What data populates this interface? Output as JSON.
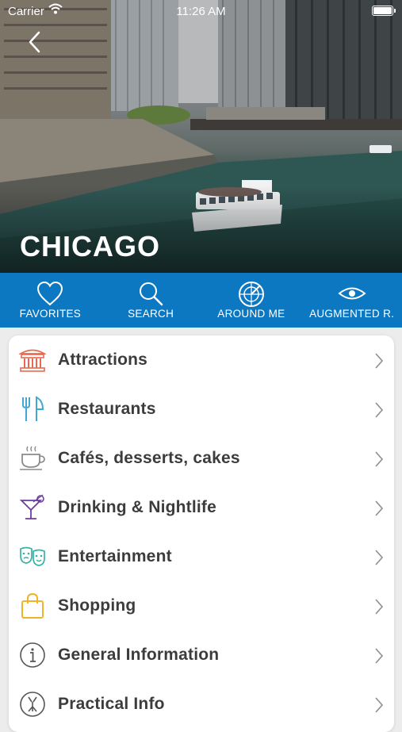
{
  "status_bar": {
    "carrier": "Carrier",
    "time": "11:26 AM"
  },
  "header": {
    "city": "CHICAGO"
  },
  "tabs": [
    {
      "label": "FAVORITES",
      "icon": "heart-icon"
    },
    {
      "label": "SEARCH",
      "icon": "search-icon"
    },
    {
      "label": "AROUND ME",
      "icon": "radar-icon"
    },
    {
      "label": "AUGMENTED R.",
      "icon": "eye-icon"
    }
  ],
  "menu": [
    {
      "label": "Attractions",
      "icon": "landmark-icon",
      "color": "#e8694f"
    },
    {
      "label": "Restaurants",
      "icon": "fork-knife-icon",
      "color": "#3fa9d6"
    },
    {
      "label": "Cafés, desserts, cakes",
      "icon": "coffee-cup-icon",
      "color": "#8a8a8a"
    },
    {
      "label": "Drinking & Nightlife",
      "icon": "cocktail-icon",
      "color": "#6b3fa0"
    },
    {
      "label": "Entertainment",
      "icon": "theater-masks-icon",
      "color": "#35b3a6"
    },
    {
      "label": "Shopping",
      "icon": "shopping-bag-icon",
      "color": "#f0b429"
    },
    {
      "label": "General Information",
      "icon": "info-icon",
      "color": "#555555"
    },
    {
      "label": "Practical Info",
      "icon": "practical-info-icon",
      "color": "#555555"
    }
  ],
  "colors": {
    "tab_bar": "#0d78c2",
    "menu_text": "#3c3c3c"
  }
}
